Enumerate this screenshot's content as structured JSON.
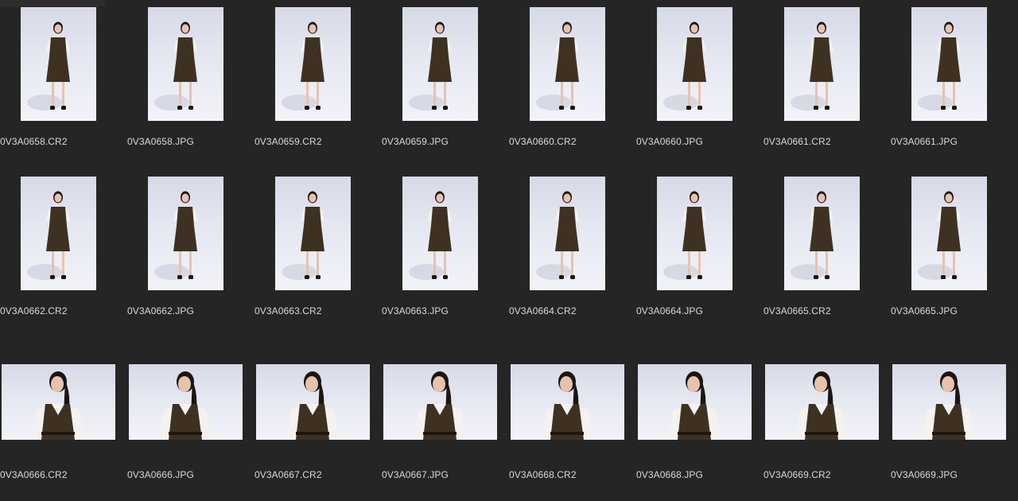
{
  "files": [
    {
      "name": "0V3A0658.CR2",
      "orientation": "portrait"
    },
    {
      "name": "0V3A0658.JPG",
      "orientation": "portrait"
    },
    {
      "name": "0V3A0659.CR2",
      "orientation": "portrait"
    },
    {
      "name": "0V3A0659.JPG",
      "orientation": "portrait"
    },
    {
      "name": "0V3A0660.CR2",
      "orientation": "portrait"
    },
    {
      "name": "0V3A0660.JPG",
      "orientation": "portrait"
    },
    {
      "name": "0V3A0661.CR2",
      "orientation": "portrait"
    },
    {
      "name": "0V3A0661.JPG",
      "orientation": "portrait"
    },
    {
      "name": "0V3A0662.CR2",
      "orientation": "portrait"
    },
    {
      "name": "0V3A0662.JPG",
      "orientation": "portrait"
    },
    {
      "name": "0V3A0663.CR2",
      "orientation": "portrait"
    },
    {
      "name": "0V3A0663.JPG",
      "orientation": "portrait"
    },
    {
      "name": "0V3A0664.CR2",
      "orientation": "portrait"
    },
    {
      "name": "0V3A0664.JPG",
      "orientation": "portrait"
    },
    {
      "name": "0V3A0665.CR2",
      "orientation": "portrait"
    },
    {
      "name": "0V3A0665.JPG",
      "orientation": "portrait"
    },
    {
      "name": "0V3A0666.CR2",
      "orientation": "landscape"
    },
    {
      "name": "0V3A0666.JPG",
      "orientation": "landscape"
    },
    {
      "name": "0V3A0667.CR2",
      "orientation": "landscape"
    },
    {
      "name": "0V3A0667.JPG",
      "orientation": "landscape"
    },
    {
      "name": "0V3A0668.CR2",
      "orientation": "landscape"
    },
    {
      "name": "0V3A0668.JPG",
      "orientation": "landscape"
    },
    {
      "name": "0V3A0669.CR2",
      "orientation": "landscape"
    },
    {
      "name": "0V3A0669.JPG",
      "orientation": "landscape"
    }
  ],
  "colors": {
    "background": "#252525",
    "label": "#d9d9d9",
    "backdrop": "#e4e6f0",
    "dress": "#3f3122",
    "blouse": "#f4f2ee",
    "hair": "#1c1512",
    "skin": "#e6c3ad"
  }
}
